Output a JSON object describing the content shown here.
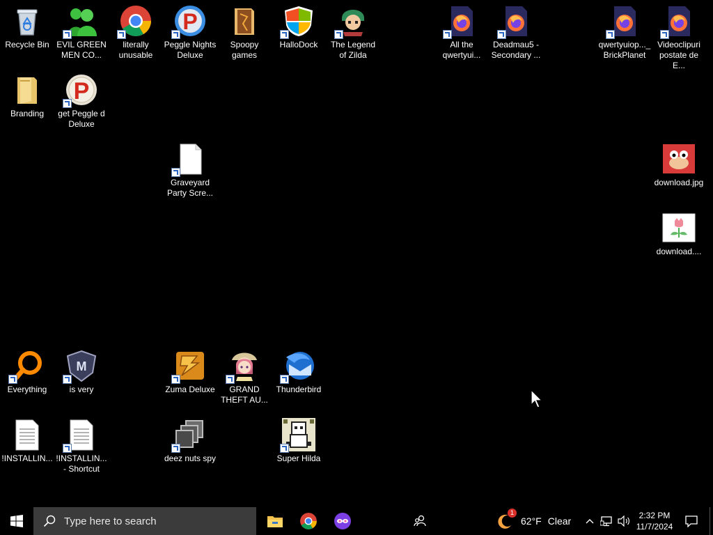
{
  "desktop": {
    "icons": [
      {
        "label": "Recycle Bin",
        "icon": "recycle-bin-icon",
        "shortcut": false
      },
      {
        "label": "EVIL GREEN MEN CO...",
        "icon": "green-men-icon",
        "shortcut": true
      },
      {
        "label": "literally unusable",
        "icon": "chrome-icon",
        "shortcut": true
      },
      {
        "label": "Peggle Nights Deluxe",
        "icon": "peggle-icon",
        "shortcut": true
      },
      {
        "label": "Spoopy games",
        "icon": "folder-icon",
        "shortcut": false
      },
      {
        "label": "HalloDock",
        "icon": "shield-icon",
        "shortcut": true
      },
      {
        "label": "The Legend of Zilda",
        "icon": "zilda-icon",
        "shortcut": true
      },
      {
        "label": "All the qwertyui...",
        "icon": "firefox-file-icon",
        "shortcut": true
      },
      {
        "label": "Deadmau5 - Secondary ...",
        "icon": "firefox-file-icon",
        "shortcut": true
      },
      {
        "label": "qwertyuiop..._ BrickPlanet",
        "icon": "firefox-file-icon",
        "shortcut": true
      },
      {
        "label": "Videoclipuri postate de E...",
        "icon": "firefox-file-icon",
        "shortcut": true
      },
      {
        "label": "Branding",
        "icon": "folder-icon",
        "shortcut": false
      },
      {
        "label": "get Peggle d Deluxe",
        "icon": "peggle-icon",
        "shortcut": true
      },
      {
        "label": "Graveyard Party Scre...",
        "icon": "blank-file-icon",
        "shortcut": true
      },
      {
        "label": "download.jpg",
        "icon": "image-file-icon",
        "shortcut": false
      },
      {
        "label": "download....",
        "icon": "tulip-image-icon",
        "shortcut": false
      },
      {
        "label": "Everything",
        "icon": "everything-search-icon",
        "shortcut": true
      },
      {
        "label": "is very",
        "icon": "shield-badge-icon",
        "shortcut": true
      },
      {
        "label": "Zuma Deluxe",
        "icon": "zuma-icon",
        "shortcut": true
      },
      {
        "label": "GRAND THEFT AU...",
        "icon": "anime-girl-icon",
        "shortcut": true
      },
      {
        "label": "Thunderbird",
        "icon": "thunderbird-icon",
        "shortcut": true
      },
      {
        "label": "!INSTALLIN...",
        "icon": "text-file-icon",
        "shortcut": false
      },
      {
        "label": "!INSTALLIN... - Shortcut",
        "icon": "text-file-icon",
        "shortcut": true
      },
      {
        "label": "deez nuts spy",
        "icon": "window-stack-icon",
        "shortcut": true
      },
      {
        "label": "Super Hilda",
        "icon": "pixel-art-icon",
        "shortcut": true
      }
    ]
  },
  "taskbar": {
    "search_placeholder": "Type here to search",
    "weather_temp": "62°F",
    "weather_text": "Clear",
    "weather_badge": "1",
    "time": "2:32 PM",
    "date": "11/7/2024"
  },
  "colors": {
    "desktop_bg": "#000000",
    "search_bg": "#3b3b3b",
    "chrome_red": "#db4437",
    "chrome_green": "#0f9d58",
    "chrome_yellow": "#f4b400",
    "chrome_blue": "#4285f4"
  }
}
